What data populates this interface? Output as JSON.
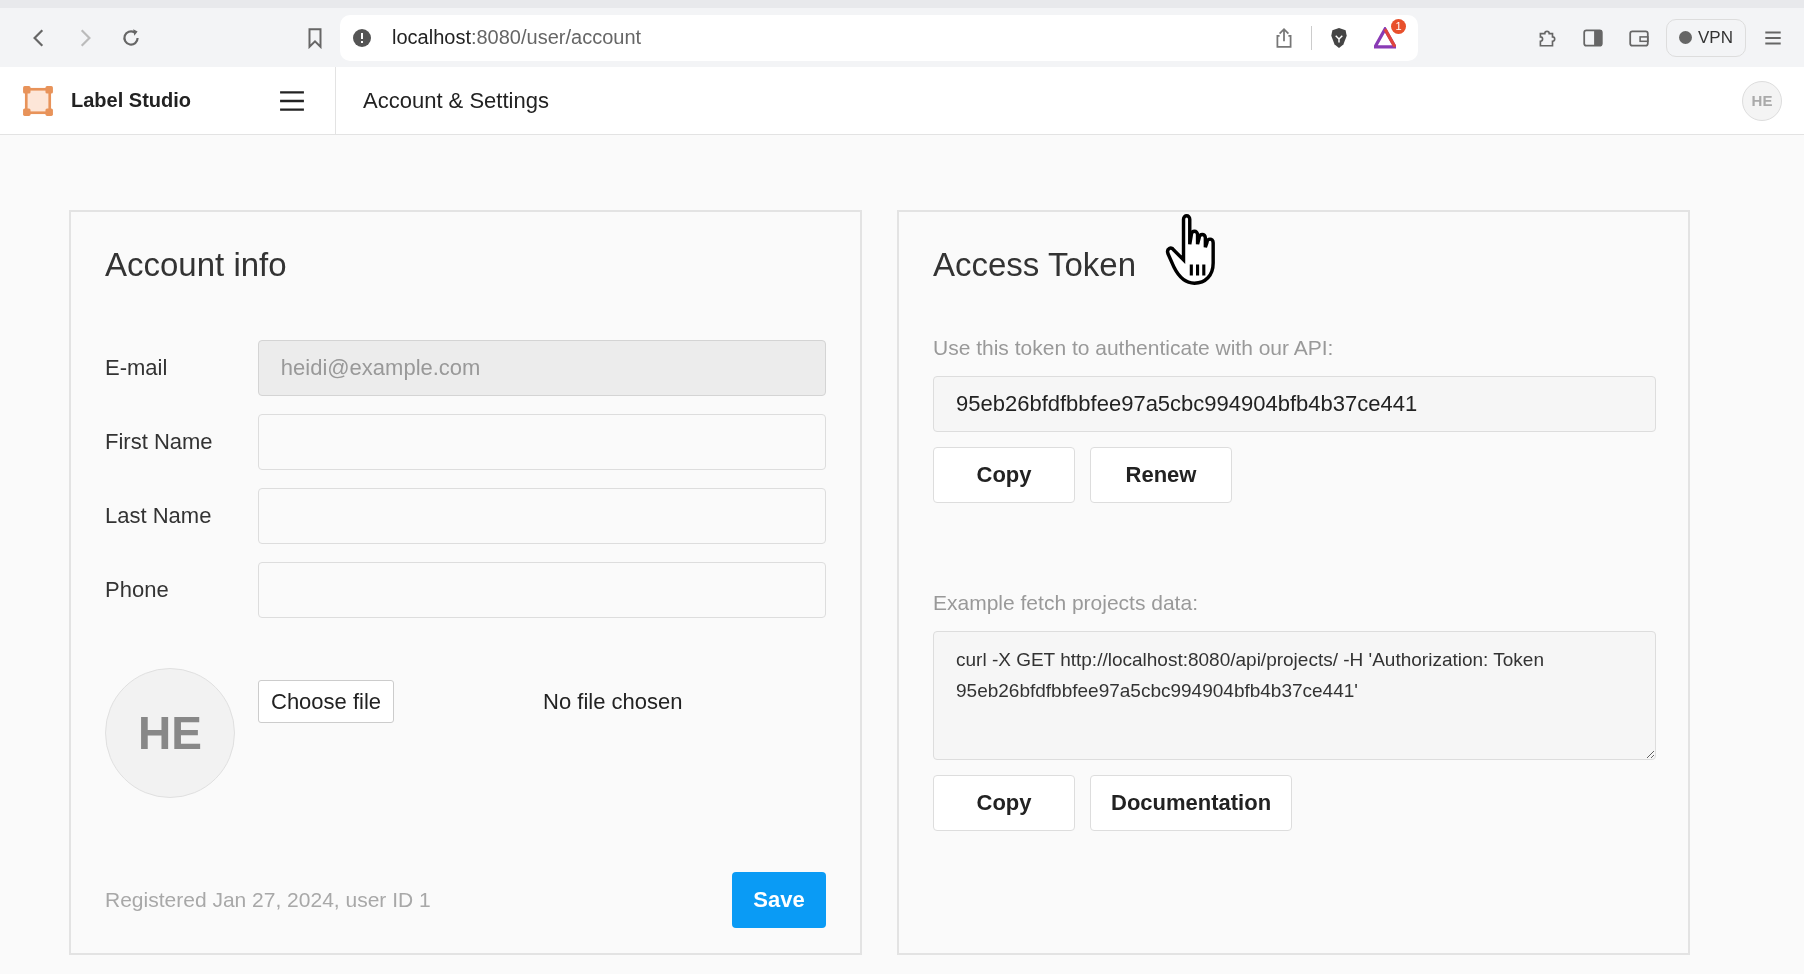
{
  "browser": {
    "url_host": "localhost",
    "url_path": ":8080/user/account",
    "notification_count": "1",
    "vpn_label": "VPN"
  },
  "app": {
    "name": "Label Studio",
    "page_title": "Account & Settings",
    "user_initials": "HE"
  },
  "account_info": {
    "title": "Account info",
    "fields": [
      {
        "label": "E-mail",
        "value": "heidi@example.com",
        "disabled": true
      },
      {
        "label": "First Name",
        "disabled": false
      },
      {
        "label": "Last Name",
        "disabled": false
      },
      {
        "label": "Phone",
        "disabled": false
      }
    ],
    "avatar_initials": "HE",
    "choose_file": "Choose file",
    "no_file": "No file chosen",
    "registered": "Registered Jan 27, 2024, user ID 1",
    "save": "Save"
  },
  "access_token": {
    "title": "Access Token",
    "description": "Use this token to authenticate with our API:",
    "token": "95eb26bfdfbbfee97a5cbc994904bfb4b37ce441",
    "token_buttons": [
      "Copy",
      "Renew"
    ],
    "example_label": "Example fetch projects data:",
    "example": "curl -X GET http://localhost:8080/api/projects/ -H 'Authorization: Token 95eb26bfdfbbfee97a5cbc994904bfb4b37ce441'",
    "example_buttons": [
      "Copy",
      "Documentation"
    ]
  }
}
